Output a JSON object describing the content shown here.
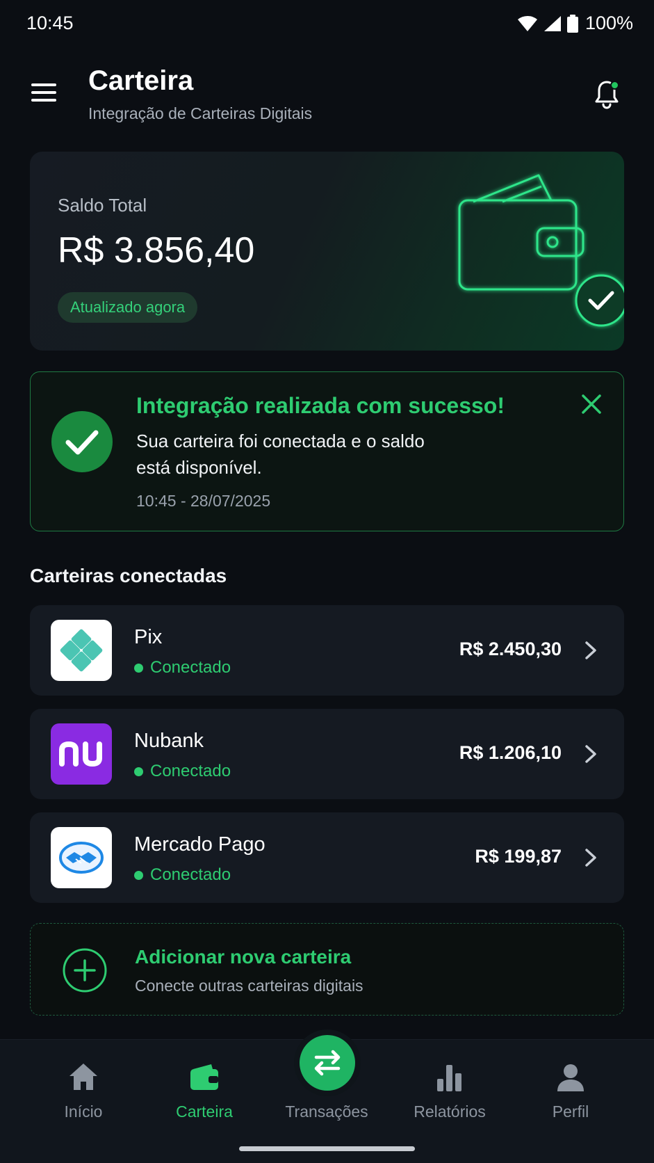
{
  "status_bar": {
    "time": "10:45",
    "battery": "100%"
  },
  "header": {
    "title": "Carteira",
    "subtitle": "Integração de Carteiras Digitais"
  },
  "balance": {
    "label": "Saldo Total",
    "value": "R$ 3.856,40",
    "badge": "Atualizado agora"
  },
  "success": {
    "title": "Integração realizada com sucesso!",
    "message": "Sua carteira foi conectada e o saldo está disponível.",
    "timestamp": "10:45 - 28/07/2025"
  },
  "wallets": {
    "section_title": "Carteiras conectadas",
    "items": [
      {
        "name": "Pix",
        "status": "Conectado",
        "amount": "R$ 2.450,30",
        "logo": "pix-logo"
      },
      {
        "name": "Nubank",
        "status": "Conectado",
        "amount": "R$ 1.206,10",
        "logo": "nubank-logo"
      },
      {
        "name": "Mercado Pago",
        "status": "Conectado",
        "amount": "R$ 199,87",
        "logo": "mercado-pago-logo"
      }
    ]
  },
  "add_wallet": {
    "title": "Adicionar nova carteira",
    "subtitle": "Conecte outras carteiras digitais"
  },
  "nav": {
    "items": [
      {
        "label": "Início",
        "icon": "home-icon"
      },
      {
        "label": "Carteira",
        "icon": "wallet-icon",
        "active": true
      },
      {
        "label": "Transações",
        "icon": "swap-icon"
      },
      {
        "label": "Relatórios",
        "icon": "bar-chart-icon"
      },
      {
        "label": "Perfil",
        "icon": "user-icon"
      }
    ]
  },
  "colors": {
    "accent": "#2ecc71",
    "background": "#0b0e13",
    "card": "#151a22",
    "nubank": "#8a2be2",
    "pix": "#4bc5b3",
    "mercado_pago": "#1e88e5"
  }
}
